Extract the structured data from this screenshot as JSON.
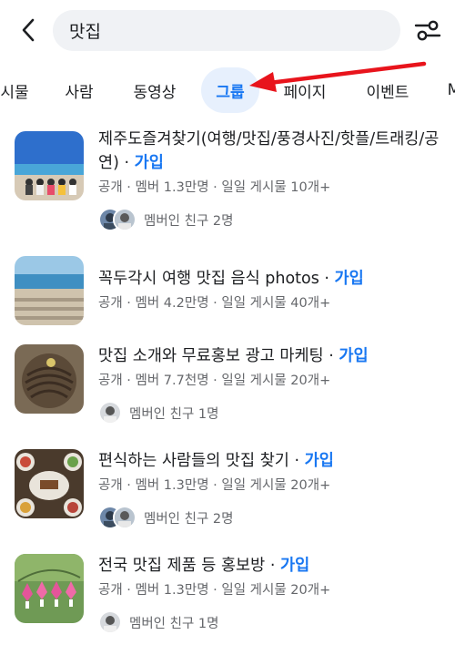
{
  "search": {
    "query": "맛집"
  },
  "tabs": [
    {
      "label": "시물",
      "active": false
    },
    {
      "label": "사람",
      "active": false
    },
    {
      "label": "동영상",
      "active": false
    },
    {
      "label": "그룹",
      "active": true
    },
    {
      "label": "페이지",
      "active": false
    },
    {
      "label": "이벤트",
      "active": false
    },
    {
      "label": "M",
      "active": false
    }
  ],
  "groups": [
    {
      "title": "제주도즐겨찾기(여행/맛집/풍경사진/핫플/트래킹/공연)",
      "join": "가입",
      "meta": "공개 · 멤버 1.3만명 · 일일 게시물 10개+",
      "friends": "멤버인 친구 2명"
    },
    {
      "title": "꼭두각시 여행 맛집 음식 photos",
      "join": "가입",
      "meta": "공개 · 멤버 4.2만명 · 일일 게시물 40개+",
      "friends": ""
    },
    {
      "title": "맛집 소개와 무료홍보 광고 마케팅",
      "join": "가입",
      "meta": "공개 · 멤버 7.7천명 · 일일 게시물 20개+",
      "friends": "멤버인 친구 1명"
    },
    {
      "title": "편식하는 사람들의 맛집 찾기",
      "join": "가입",
      "meta": "공개 · 멤버 1.3만명 · 일일 게시물 20개+",
      "friends": "멤버인 친구 2명"
    },
    {
      "title": "전국 맛집 제품 등 홍보방",
      "join": "가입",
      "meta": "공개 · 멤버 1.3만명 · 일일 게시물 20개+",
      "friends": "멤버인 친구 1명"
    }
  ],
  "colors": {
    "accent": "#1877f2",
    "annotation_arrow": "#e8141c",
    "muted_text": "#65676b"
  }
}
